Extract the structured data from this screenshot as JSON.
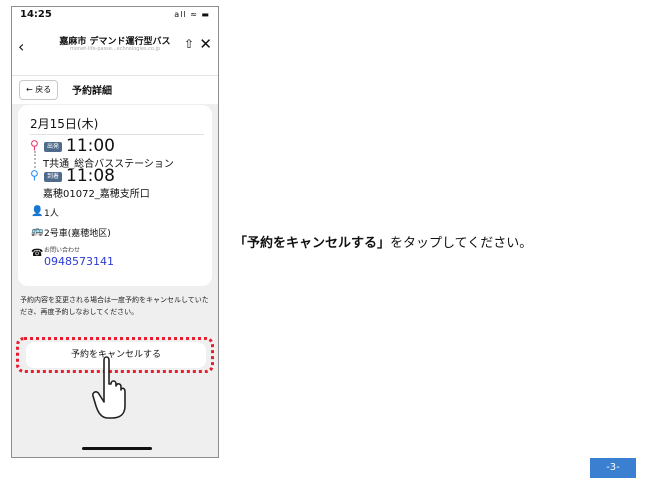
{
  "status_bar": {
    "time": "14:25",
    "icons": "all ≈ ▬"
  },
  "header": {
    "back_icon": "‹",
    "title": "嘉麻市 デマンド運行型バス",
    "url": "monet-life-passe...echnologies.co.jp",
    "share_icon": "⇧",
    "close_icon": "✕"
  },
  "subheader": {
    "back_label": "← 戻る",
    "title": "予約詳細"
  },
  "reservation": {
    "date": "2月15日(木)",
    "departure": {
      "tag": "出発",
      "time": "11:00",
      "stop": "T共通_総合バスステーション"
    },
    "arrival": {
      "tag": "到着",
      "time": "11:08",
      "stop": "嘉穂01072_嘉穂支所口"
    },
    "passengers": "1人",
    "vehicle": "2号車(嘉穂地区)",
    "contact_label": "お問い合わせ",
    "phone": "0948573141"
  },
  "notice": "予約内容を変更される場合は一度予約をキャンセルしていただき、再度予約しなおしてください。",
  "cancel_button": "予約をキャンセルする",
  "instruction": {
    "highlight": "「予約をキャンセルする」",
    "rest": "をタップしてください。"
  },
  "page_number": "-3-",
  "colors": {
    "highlight_outline": "#e61e2f",
    "phone_link": "#2a3bd6",
    "page_badge": "#3a7fd0"
  },
  "icons": [
    "back-icon",
    "share-icon",
    "close-icon",
    "location-pin-icon",
    "person-icon",
    "bus-icon",
    "phone-icon",
    "hand-pointer-icon"
  ]
}
